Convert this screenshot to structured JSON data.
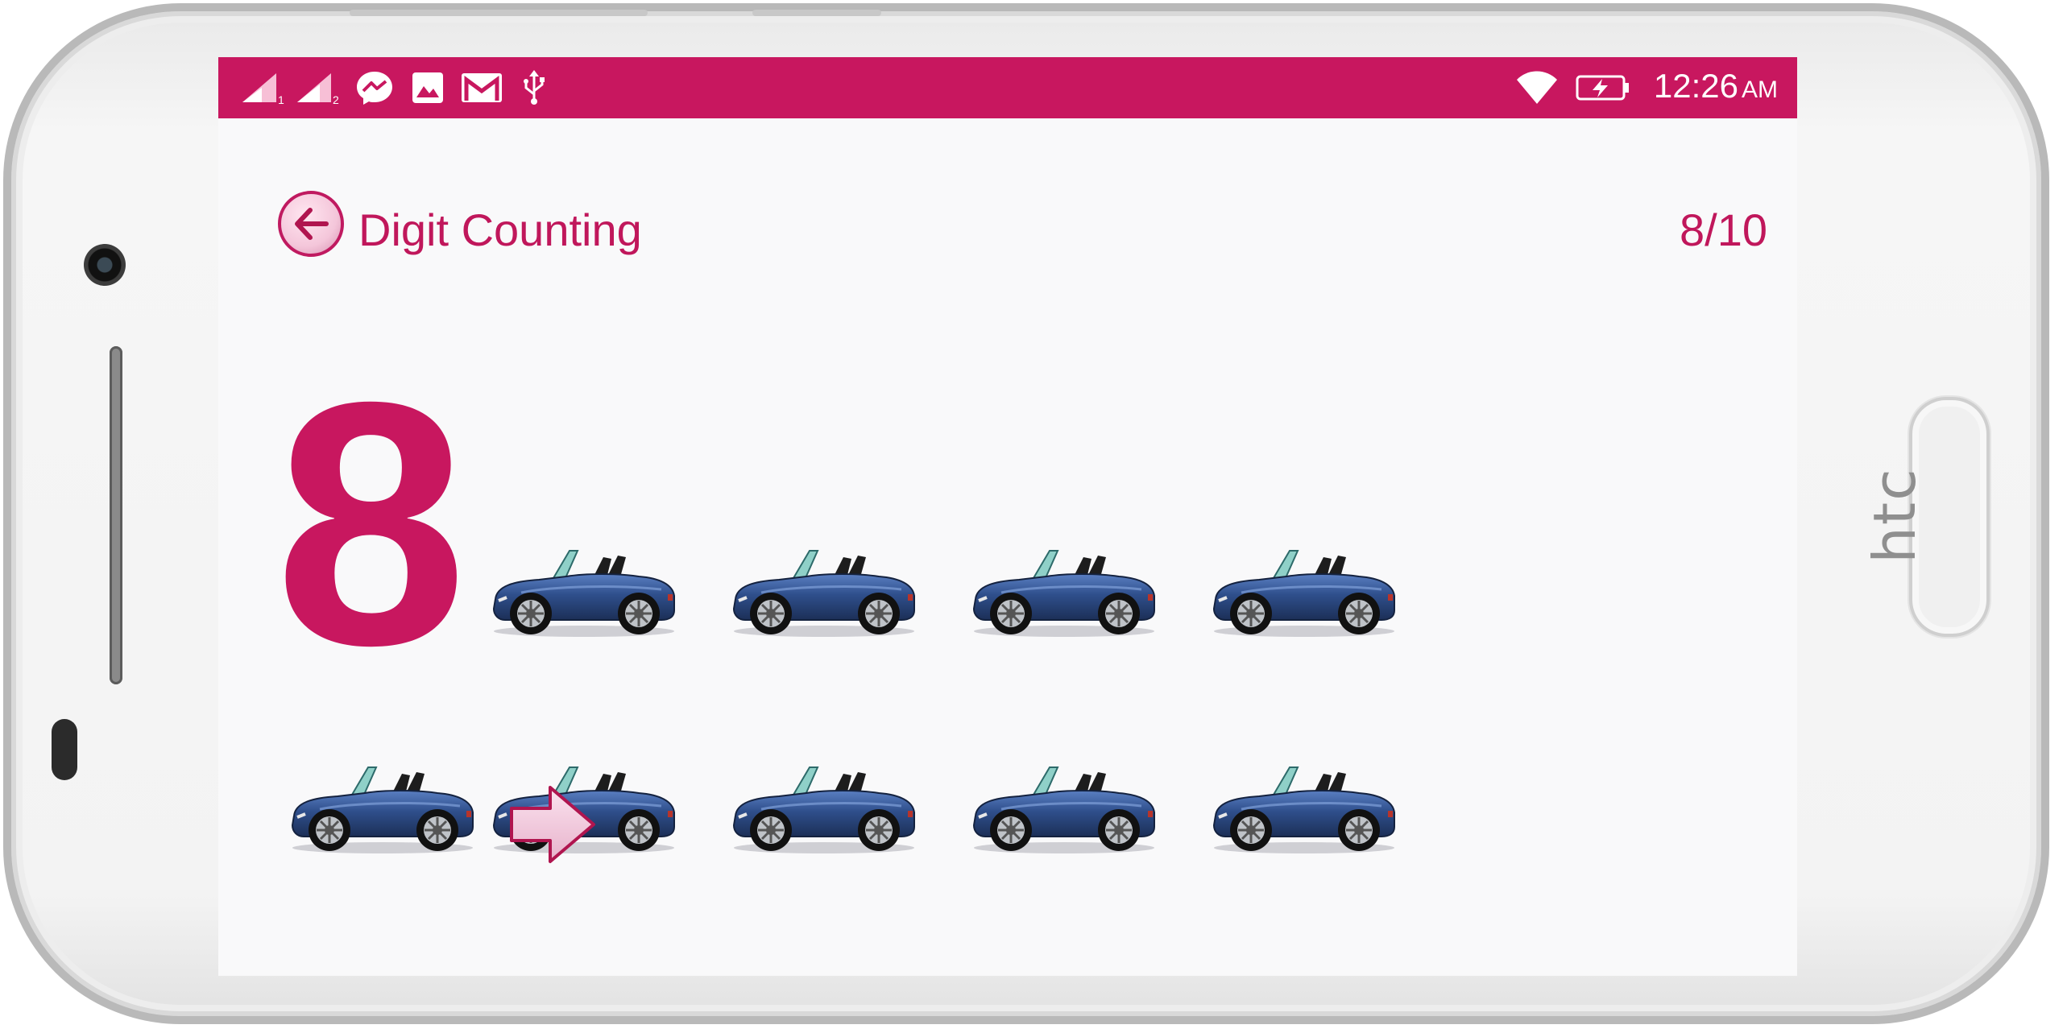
{
  "status_bar": {
    "time": "12:26",
    "ampm": "AM",
    "sim1_label": "1",
    "sim2_label": "2",
    "icons": [
      "signal-sim1-icon",
      "signal-sim2-icon",
      "messenger-icon",
      "gallery-icon",
      "gmail-icon",
      "usb-icon",
      "wifi-icon",
      "battery-charging-icon"
    ],
    "color": "#c8175f"
  },
  "header": {
    "title": "Digit Counting",
    "progress": "8/10"
  },
  "content": {
    "digit": "8",
    "count_item": "convertible-car",
    "count": 8
  },
  "theme": {
    "accent": "#c0175b",
    "car_color": "#2f4f8c",
    "background": "#f9f9fa"
  }
}
